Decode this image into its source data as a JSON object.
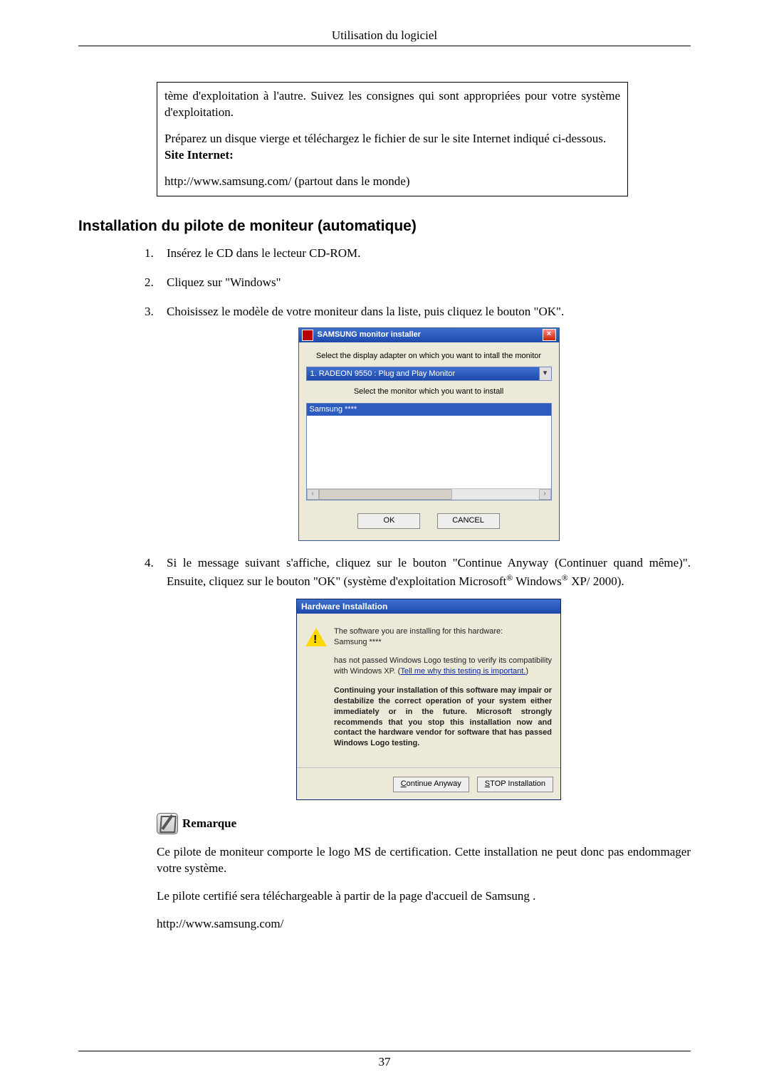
{
  "header": {
    "title": "Utilisation du logiciel"
  },
  "topbox": {
    "p1": "tème d'exploitation à l'autre. Suivez les consignes qui sont appropriées pour votre système d'exploitation.",
    "p2a": "Préparez un disque vierge et téléchargez le fichier de sur le site Internet indiqué ci-dessous.",
    "p2b": "Site Internet:",
    "p3": "http://www.samsung.com/ (partout dans le monde)"
  },
  "section": {
    "title": "Installation du pilote de moniteur (automatique)"
  },
  "steps": {
    "s1": "Insérez le CD dans le lecteur CD-ROM.",
    "s2": "Cliquez sur \"Windows\"",
    "s3": "Choisissez le modèle de votre moniteur dans la liste, puis cliquez le bouton \"OK\".",
    "s4a": "Si le message suivant s'affiche, cliquez sur le bouton \"Continue Anyway (Continuer quand même)\". Ensuite, cliquez sur le bouton \"OK\" (système d'exploitation Microsoft",
    "s4b": " Windows",
    "s4c": " XP/ 2000)."
  },
  "installer": {
    "title": "SAMSUNG monitor installer",
    "close": "×",
    "label1": "Select the display adapter on which you want to intall the monitor",
    "combo": "1. RADEON 9550 : Plug and Play Monitor",
    "combo_arrow": "▾",
    "label2": "Select the monitor which you want to install",
    "listitem": "Samsung ****",
    "scroll_left": "‹",
    "scroll_right": "›",
    "ok": "OK",
    "cancel": "CANCEL"
  },
  "hw": {
    "title": "Hardware Installation",
    "line1": "The software you are installing for this hardware:",
    "line2": "Samsung ****",
    "line3a": "has not passed Windows Logo testing to verify its compatibility with Windows XP. (",
    "line3link": "Tell me why this testing is important.",
    "line3b": ")",
    "bold": "Continuing your installation of this software may impair or destabilize the correct operation of your system either immediately or in the future. Microsoft strongly recommends that you stop this installation now and contact the hardware vendor for software that has passed Windows Logo testing.",
    "btn_continue": "Continue Anyway",
    "btn_stop": "STOP Installation"
  },
  "note": {
    "label": "Remarque"
  },
  "body": {
    "p1": "Ce pilote de moniteur comporte le logo MS de certification. Cette installation ne peut donc pas endommager votre système.",
    "p2": "Le pilote certifié sera téléchargeable à partir de la page d'accueil de Samsung .",
    "p3": "http://www.samsung.com/"
  },
  "footer": {
    "page": "37"
  },
  "reg": "®"
}
